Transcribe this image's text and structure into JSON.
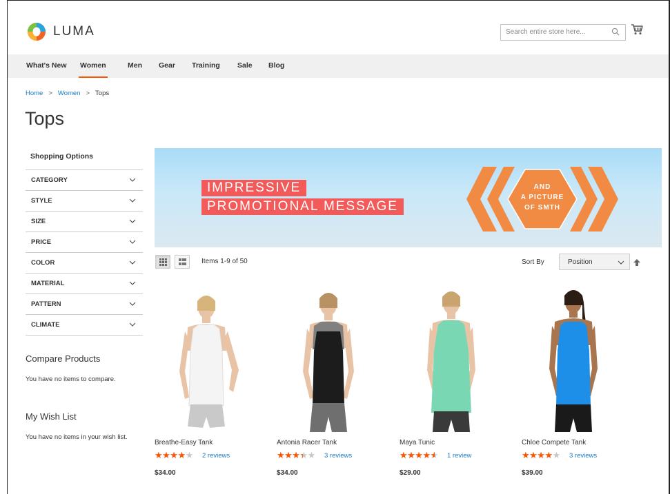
{
  "brand": {
    "name": "LUMA"
  },
  "search": {
    "placeholder": "Search entire store here..."
  },
  "nav": {
    "items": [
      {
        "label": "What's New",
        "active": false
      },
      {
        "label": "Women",
        "active": true
      },
      {
        "label": "Men",
        "active": false
      },
      {
        "label": "Gear",
        "active": false
      },
      {
        "label": "Training",
        "active": false
      },
      {
        "label": "Sale",
        "active": false
      },
      {
        "label": "Blog",
        "active": false
      }
    ]
  },
  "breadcrumb": {
    "home": "Home",
    "sep": ">",
    "women": "Women",
    "current": "Tops"
  },
  "page": {
    "title": "Tops"
  },
  "sidebar": {
    "title": "Shopping Options",
    "filters": [
      "CATEGORY",
      "STYLE",
      "SIZE",
      "PRICE",
      "COLOR",
      "MATERIAL",
      "PATTERN",
      "CLIMATE"
    ],
    "compare_title": "Compare Products",
    "compare_text": "You have no items to compare.",
    "wishlist_title": "My Wish List",
    "wishlist_text": "You have no items in your wish list."
  },
  "banner": {
    "line1": "IMPRESSIVE",
    "line2": "PROMOTIONAL MESSAGE",
    "badge_line1": "AND",
    "badge_line2": "A PICTURE",
    "badge_line3": "OF SMTH"
  },
  "toolbar": {
    "items_count": "Items 1-9 of 50",
    "sort_label": "Sort By",
    "sort_value": "Position"
  },
  "products": [
    {
      "name": "Breathe-Easy Tank",
      "rating_pct": 70,
      "reviews": "2 reviews",
      "price": "$34.00",
      "top_color": "#f4f4f4",
      "shorts_color": "#c9c9c9"
    },
    {
      "name": "Antonia Racer Tank",
      "rating_pct": 60,
      "reviews": "3 reviews",
      "price": "$34.00",
      "top_color": "#1c1c1c",
      "shorts_color": "#6f6f6f"
    },
    {
      "name": "Maya Tunic",
      "rating_pct": 80,
      "reviews": "1 review",
      "price": "$29.00",
      "top_color": "#79d8b3",
      "shorts_color": "#3a3a3a"
    },
    {
      "name": "Chloe Compete Tank",
      "rating_pct": 70,
      "reviews": "3 reviews",
      "price": "$39.00",
      "top_color": "#1e8fe8",
      "shorts_color": "#1a1a1a"
    }
  ],
  "colors": {
    "accent": "#ff5501",
    "link": "#1979c3",
    "promo_red": "#f35b5b",
    "badge_orange": "#f18b44"
  }
}
